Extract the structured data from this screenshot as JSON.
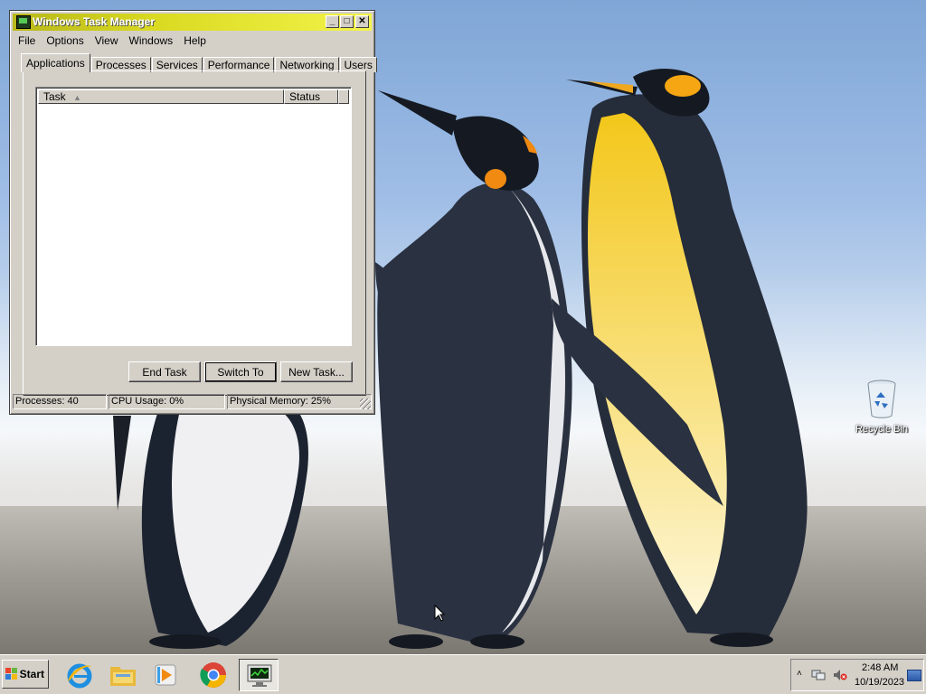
{
  "window": {
    "title": "Windows Task Manager",
    "controls": {
      "minimize": "_",
      "maximize": "□",
      "close": "✕"
    }
  },
  "menu": [
    "File",
    "Options",
    "View",
    "Windows",
    "Help"
  ],
  "tabs": [
    "Applications",
    "Processes",
    "Services",
    "Performance",
    "Networking",
    "Users"
  ],
  "active_tab": "Applications",
  "list": {
    "columns": [
      "Task",
      "Status"
    ],
    "sort_indicator": "▲",
    "rows": []
  },
  "buttons": {
    "end_task": "End Task",
    "switch_to": "Switch To",
    "new_task": "New Task..."
  },
  "statusbar": {
    "processes": "Processes: 40",
    "cpu": "CPU Usage: 0%",
    "memory": "Physical Memory: 25%"
  },
  "desktop": {
    "recycle_bin_label": "Recycle Bin"
  },
  "taskbar": {
    "start_label": "Start",
    "apps": [
      "internet-explorer-icon",
      "file-explorer-icon",
      "media-player-icon",
      "chrome-icon",
      "task-manager-icon"
    ],
    "tray": {
      "expand": "˄",
      "time": "2:48 AM",
      "date": "10/19/2023"
    }
  },
  "colors": {
    "title_bar_start": "#b7b71a",
    "title_bar_end": "#f3f34a",
    "chrome_face": "#d4d0c8"
  }
}
